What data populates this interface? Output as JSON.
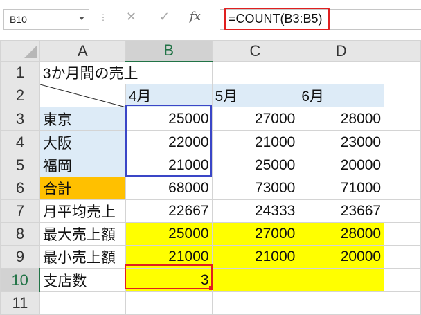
{
  "name_box": {
    "value": "B10",
    "dropdown_icon": "chevron-down-icon"
  },
  "formula_bar": {
    "separator": "⋮",
    "cancel_icon": "close-icon",
    "enter_icon": "check-icon",
    "fx_label": "fx",
    "formula": "=COUNT(B3:B5)"
  },
  "sheet": {
    "columns": [
      "A",
      "B",
      "C",
      "D"
    ],
    "rows": [
      "1",
      "2",
      "3",
      "4",
      "5",
      "6",
      "7",
      "8",
      "9",
      "10",
      "11"
    ],
    "cells": {
      "A1": "3か月間の売上",
      "B2": "4月",
      "C2": "5月",
      "D2": "6月",
      "A3": "東京",
      "B3": "25000",
      "C3": "27000",
      "D3": "28000",
      "A4": "大阪",
      "B4": "22000",
      "C4": "21000",
      "D4": "23000",
      "A5": "福岡",
      "B5": "21000",
      "C5": "25000",
      "D5": "20000",
      "A6": "合計",
      "B6": "68000",
      "C6": "73000",
      "D6": "71000",
      "A7": "月平均売上",
      "B7": "22667",
      "C7": "24333",
      "D7": "23667",
      "A8": "最大売上額",
      "B8": "25000",
      "C8": "27000",
      "D8": "28000",
      "A9": "最小売上額",
      "B9": "21000",
      "C9": "21000",
      "D9": "20000",
      "A10": "支店数",
      "B10": "3"
    },
    "active_cell": "B10",
    "highlighted_range": "B3:B5",
    "colors": {
      "header_blue": "#ddebf7",
      "yellow": "#ffff00",
      "orange": "#ffc000",
      "range_border": "#3a46c7",
      "highlight_red": "#e02020"
    }
  }
}
